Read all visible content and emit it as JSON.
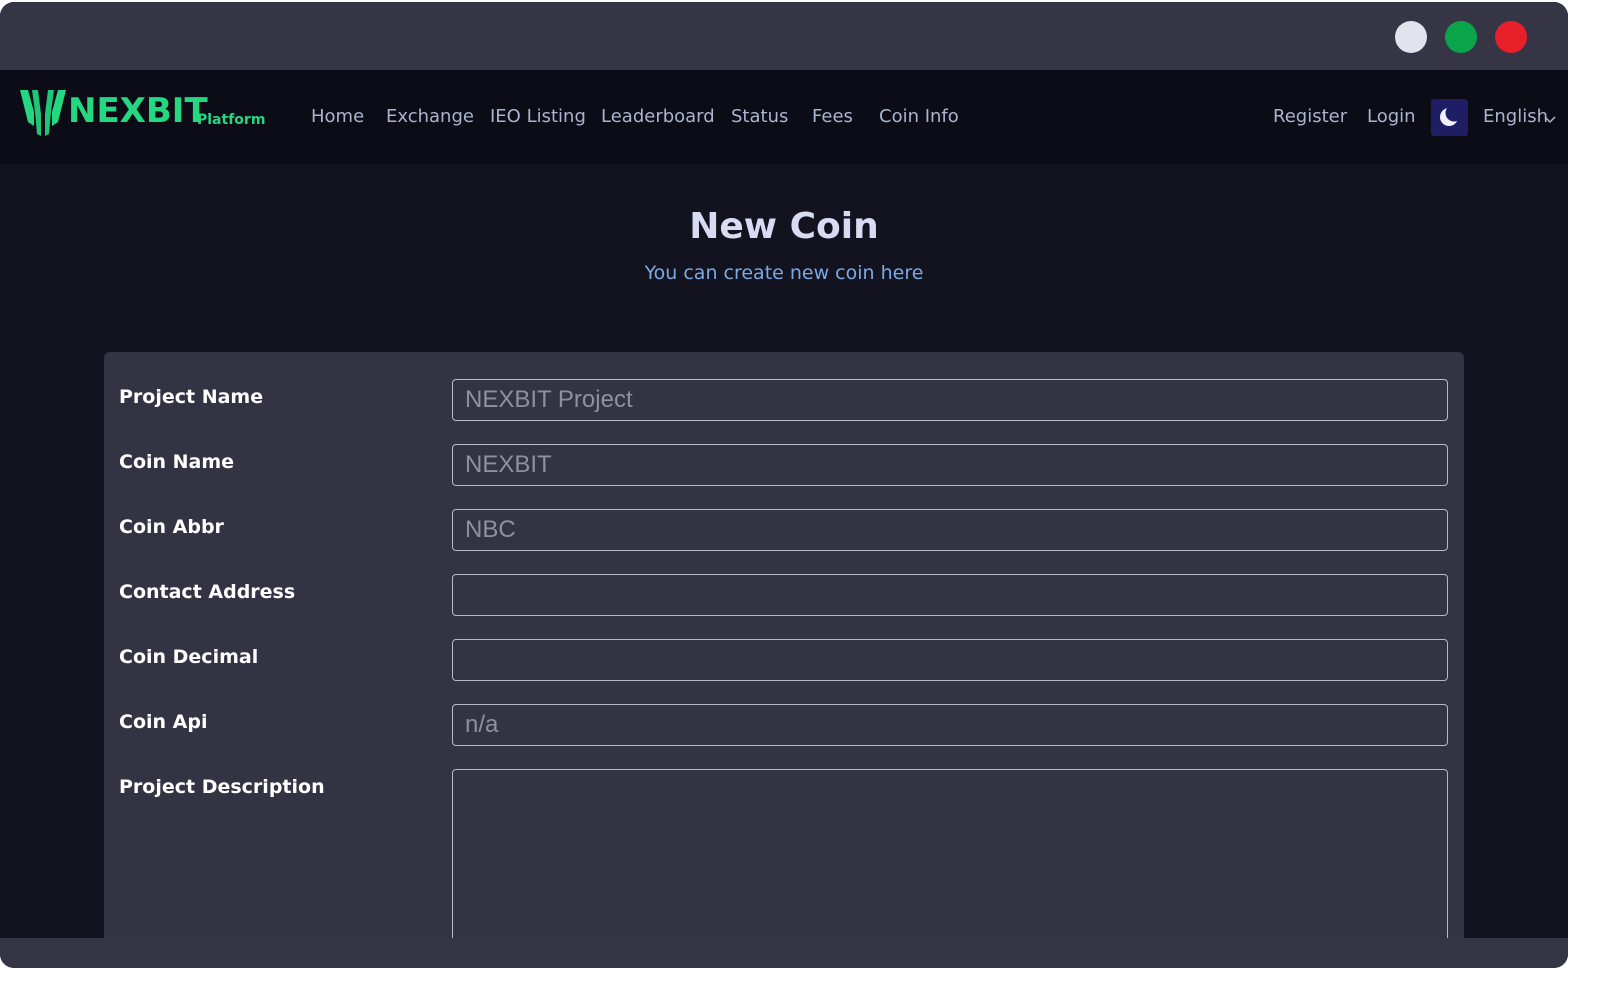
{
  "brand": {
    "name": "NEXBIT",
    "sub": "Platform",
    "accent": "#24d882"
  },
  "nav": {
    "links": [
      "Home",
      "Exchange",
      "IEO Listing",
      "Leaderboard",
      "Status",
      "Fees",
      "Coin Info"
    ],
    "register": "Register",
    "login": "Login",
    "language": "English",
    "theme_icon": "moon-icon"
  },
  "page": {
    "title": "New Coin",
    "subtitle": "You can create new coin here"
  },
  "form": {
    "fields": [
      {
        "label": "Project Name",
        "placeholder": "NEXBIT Project",
        "value": ""
      },
      {
        "label": "Coin Name",
        "placeholder": "NEXBIT",
        "value": ""
      },
      {
        "label": "Coin Abbr",
        "placeholder": "NBC",
        "value": ""
      },
      {
        "label": "Contact Address",
        "placeholder": "",
        "value": ""
      },
      {
        "label": "Coin Decimal",
        "placeholder": "",
        "value": ""
      },
      {
        "label": "Coin Api",
        "placeholder": "n/a",
        "value": ""
      },
      {
        "label": "Project Description",
        "placeholder": "",
        "value": ""
      }
    ]
  },
  "colors": {
    "window_chrome": "#353545",
    "navbar": "#0c0c16",
    "page_bg": "#13131f",
    "card_bg": "#333344",
    "subtitle": "#79a9e6"
  }
}
